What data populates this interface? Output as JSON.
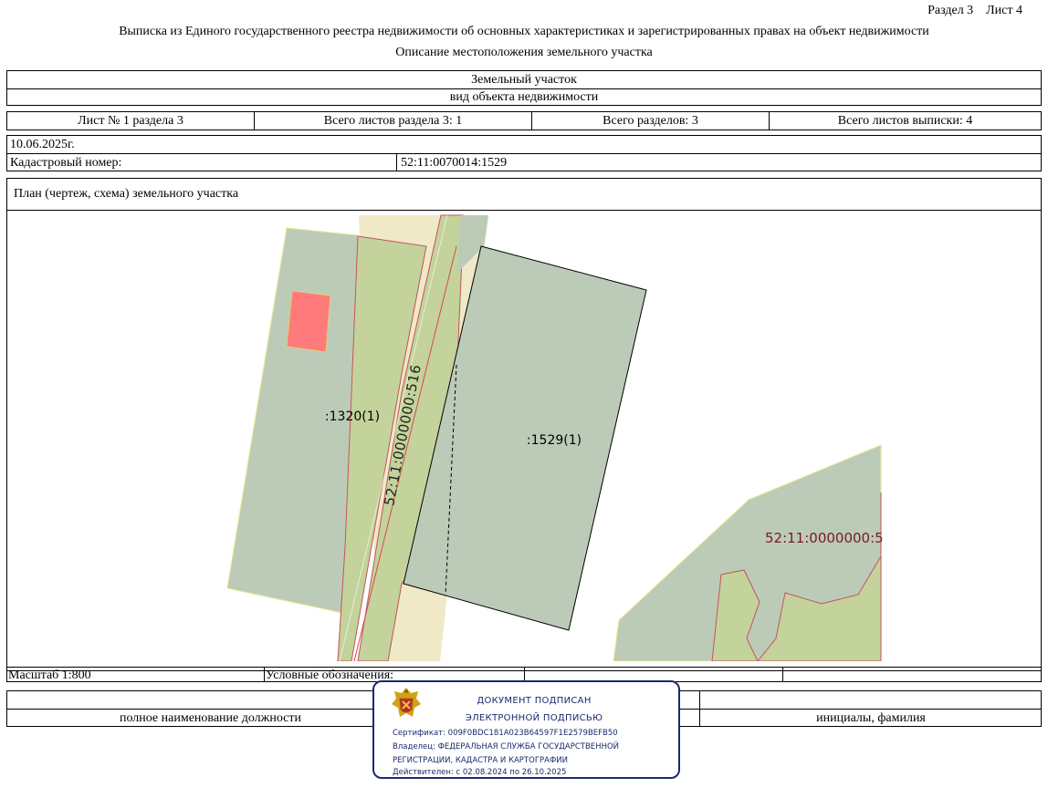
{
  "header": {
    "section_sheet": "Раздел 3    Лист 4",
    "title": "Выписка из Единого государственного реестра недвижимости об основных характеристиках и зарегистрированных правах на объект недвижимости",
    "subtitle": "Описание местоположения земельного участка"
  },
  "object": {
    "type": "Земельный участок",
    "type_caption": "вид объекта недвижимости"
  },
  "sheets": {
    "sheet_no": "Лист № 1 раздела 3",
    "sheets_in_section": "Всего листов раздела 3: 1",
    "sections_total": "Всего разделов: 3",
    "sheets_total": "Всего листов выписки: 4"
  },
  "date": "10.06.2025г.",
  "cadastral": {
    "label": "Кадастровый номер:",
    "value": "52:11:0070014:1529"
  },
  "plan": {
    "title": "План (чертеж, схема) земельного участка",
    "labels": {
      "parcel_1320": ":1320(1)",
      "parcel_1529": ":1529(1)",
      "road": "52:11:0000000:516",
      "right_parcel": "52:11:0000000:5"
    }
  },
  "footer": {
    "scale": "Масштаб 1:800",
    "legend": "Условные обозначения:",
    "position_caption": "полное наименование должности",
    "name_caption": "инициалы, фамилия"
  },
  "stamp": {
    "line1": "ДОКУМЕНТ ПОДПИСАН",
    "line2": "ЭЛЕКТРОННОЙ ПОДПИСЬЮ",
    "certificate": "Сертификат: 009F0BDC181A023B64597F1E2579BEFB50",
    "owner1": "Владелец: ФЕДЕРАЛЬНАЯ СЛУЖБА ГОСУДАРСТВЕННОЙ",
    "owner2": "РЕГИСТРАЦИИ, КАДАСТРА И КАРТОГРАФИИ",
    "validity": "Действителен: с 02.08.2024 по 26.10.2025"
  },
  "colors": {
    "parcel_gray": "#bccbb8",
    "parcel_green": "#c3d39b",
    "road_beige": "#efe9c8",
    "building_red": "#ff7b7b",
    "boundary_red": "#d9484f",
    "stamp_blue": "#1b2a6b"
  }
}
